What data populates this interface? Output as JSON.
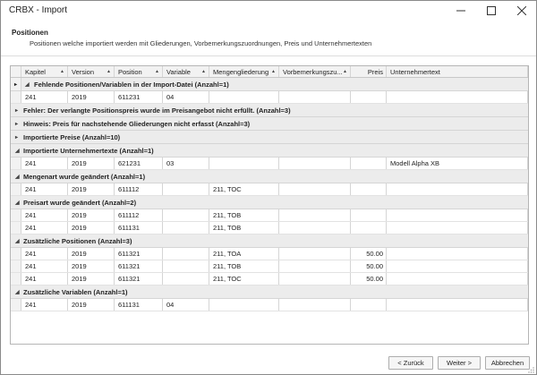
{
  "window": {
    "title": "CRBX - Import"
  },
  "header": {
    "title": "Positionen",
    "description": "Positionen welche importiert werden mit Gliederungen, Vorbemerkungszuordnungen, Preis und Unternehmertexten"
  },
  "grid": {
    "columns": [
      {
        "label": "Kapitel",
        "sort": "▲"
      },
      {
        "label": "Version",
        "sort": "▲"
      },
      {
        "label": "Position",
        "sort": "▲"
      },
      {
        "label": "Variable",
        "sort": "▲"
      },
      {
        "label": "Mengengliederung",
        "sort": "▲"
      },
      {
        "label": "Vorbemerkungszu...",
        "sort": "▲"
      },
      {
        "label": "Preis",
        "sort": ""
      },
      {
        "label": "Unternehmertext",
        "sort": ""
      }
    ],
    "rows": [
      {
        "type": "group",
        "label": "Fehlende Positionen/Variablen in der Import-Datei (Anzahl=1)",
        "expanded": true,
        "current": true
      },
      {
        "type": "data",
        "cells": [
          "241",
          "2019",
          "611231",
          "04",
          "",
          "",
          "",
          ""
        ]
      },
      {
        "type": "group",
        "label": "Fehler: Der verlangte Positionspreis wurde im Preisangebot nicht erfüllt. (Anzahl=3)",
        "expanded": false
      },
      {
        "type": "group",
        "label": "Hinweis: Preis für nachstehende Gliederungen nicht erfasst (Anzahl=3)",
        "expanded": false
      },
      {
        "type": "group",
        "label": "Importierte Preise (Anzahl=10)",
        "expanded": false
      },
      {
        "type": "group",
        "label": "Importierte Unternehmertexte (Anzahl=1)",
        "expanded": true
      },
      {
        "type": "data",
        "cells": [
          "241",
          "2019",
          "621231",
          "03",
          "",
          "",
          "",
          "Modell Alpha XB"
        ]
      },
      {
        "type": "group",
        "label": "Mengenart wurde geändert (Anzahl=1)",
        "expanded": true
      },
      {
        "type": "data",
        "cells": [
          "241",
          "2019",
          "611112",
          "",
          "211, TOC",
          "",
          "",
          ""
        ]
      },
      {
        "type": "group",
        "label": "Preisart wurde geändert (Anzahl=2)",
        "expanded": true
      },
      {
        "type": "data",
        "cells": [
          "241",
          "2019",
          "611112",
          "",
          "211, TOB",
          "",
          "",
          ""
        ]
      },
      {
        "type": "data",
        "cells": [
          "241",
          "2019",
          "611131",
          "",
          "211, TOB",
          "",
          "",
          ""
        ]
      },
      {
        "type": "group",
        "label": "Zusätzliche Positionen (Anzahl=3)",
        "expanded": true
      },
      {
        "type": "data",
        "cells": [
          "241",
          "2019",
          "611321",
          "",
          "211, TOA",
          "",
          "50.00",
          ""
        ]
      },
      {
        "type": "data",
        "cells": [
          "241",
          "2019",
          "611321",
          "",
          "211, TOB",
          "",
          "50.00",
          ""
        ]
      },
      {
        "type": "data",
        "cells": [
          "241",
          "2019",
          "611321",
          "",
          "211, TOC",
          "",
          "50.00",
          ""
        ]
      },
      {
        "type": "group",
        "label": "Zusätzliche Variablen (Anzahl=1)",
        "expanded": true
      },
      {
        "type": "data",
        "cells": [
          "241",
          "2019",
          "611131",
          "04",
          "",
          "",
          "",
          ""
        ]
      }
    ]
  },
  "footer": {
    "back_label": "< Zurück",
    "next_label": "Weiter >",
    "cancel_label": "Abbrechen"
  }
}
